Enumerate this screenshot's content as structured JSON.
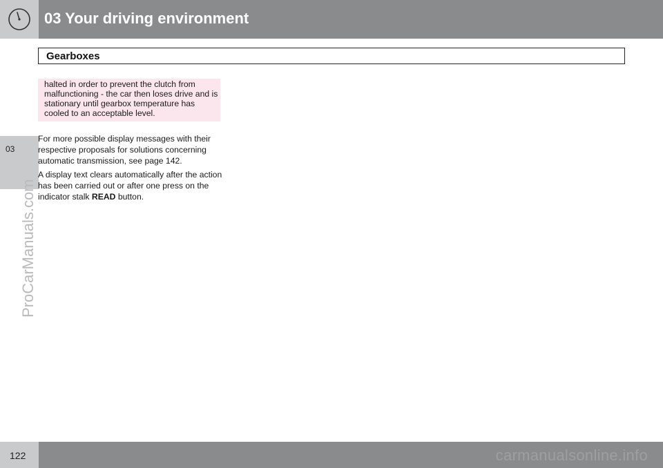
{
  "header": {
    "title": "03 Your driving environment",
    "icon": "speedometer-icon"
  },
  "section": {
    "title": "Gearboxes"
  },
  "side_tab": {
    "label": "03"
  },
  "note": {
    "text": "halted in order to prevent the clutch from malfunctioning - the car then loses drive and is stationary until gearbox temperature has cooled to an acceptable level."
  },
  "body": {
    "para1": "For more possible display messages with their respective proposals for solutions concerning automatic transmission, see page 142.",
    "para2_before": "A display text clears automatically after the action has been carried out or after one press on the indicator stalk ",
    "para2_bold": "READ",
    "para2_after": " button."
  },
  "footer": {
    "page_number": "122"
  },
  "watermarks": {
    "left": "ProCarManuals.com",
    "bottom": "carmanualsonline.info"
  },
  "colors": {
    "header_bar": "#8a8b8d",
    "tab_grey": "#c9cacc",
    "note_pink": "#fbe6ee"
  }
}
